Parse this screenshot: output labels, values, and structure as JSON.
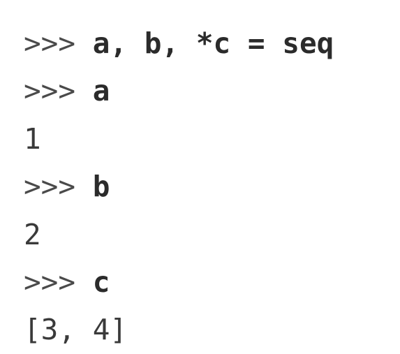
{
  "console": {
    "lines": [
      {
        "type": "input",
        "prompt": ">>> ",
        "text": "a, b, *c = seq"
      },
      {
        "type": "input",
        "prompt": ">>> ",
        "text": "a"
      },
      {
        "type": "output",
        "text": "1"
      },
      {
        "type": "input",
        "prompt": ">>> ",
        "text": "b"
      },
      {
        "type": "output",
        "text": "2"
      },
      {
        "type": "input",
        "prompt": ">>> ",
        "text": "c"
      },
      {
        "type": "output",
        "text": "[3, 4]"
      }
    ]
  }
}
